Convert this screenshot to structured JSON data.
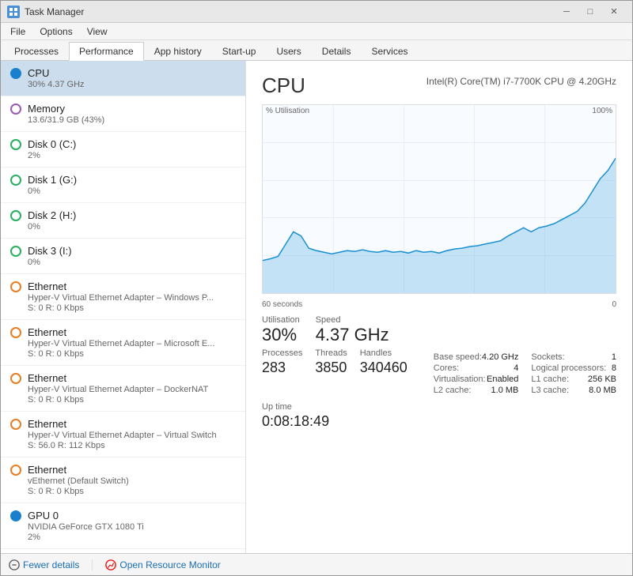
{
  "window": {
    "title": "Task Manager",
    "controls": {
      "minimize": "─",
      "maximize": "□",
      "close": "✕"
    }
  },
  "menu": {
    "items": [
      "File",
      "Options",
      "View"
    ]
  },
  "tabs": [
    {
      "label": "Processes",
      "active": false
    },
    {
      "label": "Performance",
      "active": true
    },
    {
      "label": "App history",
      "active": false
    },
    {
      "label": "Start-up",
      "active": false
    },
    {
      "label": "Users",
      "active": false
    },
    {
      "label": "Details",
      "active": false
    },
    {
      "label": "Services",
      "active": false
    }
  ],
  "sidebar": {
    "items": [
      {
        "name": "CPU",
        "sub": "30%  4.37 GHz",
        "dot": "blue",
        "active": true
      },
      {
        "name": "Memory",
        "sub": "13.6/31.9 GB (43%)",
        "dot": "purple",
        "active": false
      },
      {
        "name": "Disk 0 (C:)",
        "sub": "2%",
        "dot": "green",
        "active": false
      },
      {
        "name": "Disk 1 (G:)",
        "sub": "0%",
        "dot": "green",
        "active": false
      },
      {
        "name": "Disk 2 (H:)",
        "sub": "0%",
        "dot": "green",
        "active": false
      },
      {
        "name": "Disk 3 (I:)",
        "sub": "0%",
        "dot": "green",
        "active": false
      },
      {
        "name": "Ethernet",
        "sub1": "Hyper-V Virtual Ethernet Adapter – Windows P...",
        "sub2": "S: 0 R: 0 Kbps",
        "dot": "orange",
        "active": false
      },
      {
        "name": "Ethernet",
        "sub1": "Hyper-V Virtual Ethernet Adapter – Microsoft E...",
        "sub2": "S: 0 R: 0 Kbps",
        "dot": "orange",
        "active": false
      },
      {
        "name": "Ethernet",
        "sub1": "Hyper-V Virtual Ethernet Adapter – DockerNAT",
        "sub2": "S: 0 R: 0 Kbps",
        "dot": "orange",
        "active": false
      },
      {
        "name": "Ethernet",
        "sub1": "Hyper-V Virtual Ethernet Adapter – Virtual Switch",
        "sub2": "S: 56.0  R: 112 Kbps",
        "dot": "orange",
        "active": false
      },
      {
        "name": "Ethernet",
        "sub1": "vEthernet (Default Switch)",
        "sub2": "S: 0 R: 0 Kbps",
        "dot": "orange",
        "active": false
      },
      {
        "name": "GPU 0",
        "sub": "NVIDIA GeForce GTX 1080 Ti",
        "sub2": "2%",
        "dot": "blue",
        "active": false
      }
    ]
  },
  "main": {
    "cpu_title": "CPU",
    "cpu_model": "Intel(R) Core(TM) i7-7700K CPU @ 4.20GHz",
    "chart": {
      "y_label": "% Utilisation",
      "y_max": "100%",
      "x_label": "60 seconds",
      "x_right": "0"
    },
    "stats": {
      "utilisation_label": "Utilisation",
      "utilisation_value": "30%",
      "speed_label": "Speed",
      "speed_value": "4.37 GHz",
      "processes_label": "Processes",
      "processes_value": "283",
      "threads_label": "Threads",
      "threads_value": "3850",
      "handles_label": "Handles",
      "handles_value": "340460",
      "uptime_label": "Up time",
      "uptime_value": "0:08:18:49"
    },
    "details": [
      {
        "key": "Base speed:",
        "val": "4.20 GHz"
      },
      {
        "key": "Sockets:",
        "val": "1"
      },
      {
        "key": "Cores:",
        "val": "4"
      },
      {
        "key": "Logical processors:",
        "val": "8"
      },
      {
        "key": "Virtualisation:",
        "val": "Enabled"
      },
      {
        "key": "L1 cache:",
        "val": "256 KB"
      },
      {
        "key": "L2 cache:",
        "val": "1.0 MB"
      },
      {
        "key": "L3 cache:",
        "val": "8.0 MB"
      }
    ]
  },
  "footer": {
    "fewer_details": "Fewer details",
    "open_resource_monitor": "Open Resource Monitor"
  }
}
